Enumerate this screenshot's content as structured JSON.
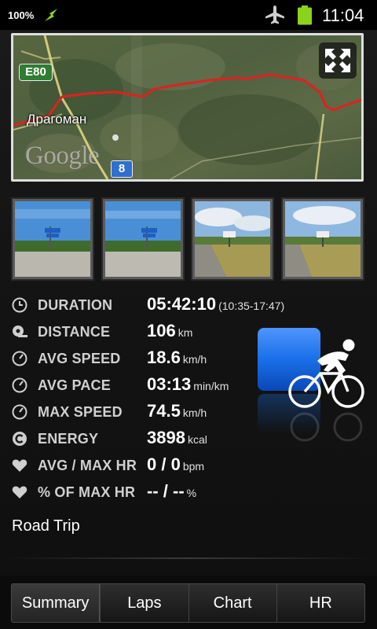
{
  "status_bar": {
    "battery_percent": "100%",
    "time": "11:04",
    "icons": [
      "charging-icon",
      "airplane-mode-icon",
      "battery-full-icon"
    ]
  },
  "map": {
    "town_label": "Драгоман",
    "road_e80": "E80",
    "road_8": "8",
    "google_mark": "Google",
    "route_color": "#e02020",
    "expand_icon": "fullscreen-expand-icon"
  },
  "photos": [
    {
      "name": "photo-1"
    },
    {
      "name": "photo-2"
    },
    {
      "name": "photo-3"
    },
    {
      "name": "photo-4"
    }
  ],
  "stats": [
    {
      "icon": "clock-icon",
      "label": "DURATION",
      "value": "05:42:10",
      "unit": "(10:35-17:47)"
    },
    {
      "icon": "distance-icon",
      "label": "DISTANCE",
      "value": "106",
      "unit": "km"
    },
    {
      "icon": "speedometer-icon",
      "label": "AVG SPEED",
      "value": "18.6",
      "unit": "km/h"
    },
    {
      "icon": "speedometer-icon",
      "label": "AVG PACE",
      "value": "03:13",
      "unit": "min/km"
    },
    {
      "icon": "speedometer-icon",
      "label": "MAX SPEED",
      "value": "74.5",
      "unit": "km/h"
    },
    {
      "icon": "energy-icon",
      "label": "ENERGY",
      "value": "3898",
      "unit": "kcal"
    },
    {
      "icon": "heart-icon",
      "label": "AVG / MAX HR",
      "value": "0 / 0",
      "unit": "bpm"
    },
    {
      "icon": "heart-icon",
      "label": "% OF MAX HR",
      "value": "-- / --",
      "unit": "%"
    }
  ],
  "activity": {
    "icon": "cycling-icon",
    "accent": "#1a6fe8"
  },
  "trip_name": "Road Trip",
  "tabs": [
    {
      "label": "Summary",
      "active": true
    },
    {
      "label": "Laps",
      "active": false
    },
    {
      "label": "Chart",
      "active": false
    },
    {
      "label": "HR",
      "active": false
    }
  ]
}
